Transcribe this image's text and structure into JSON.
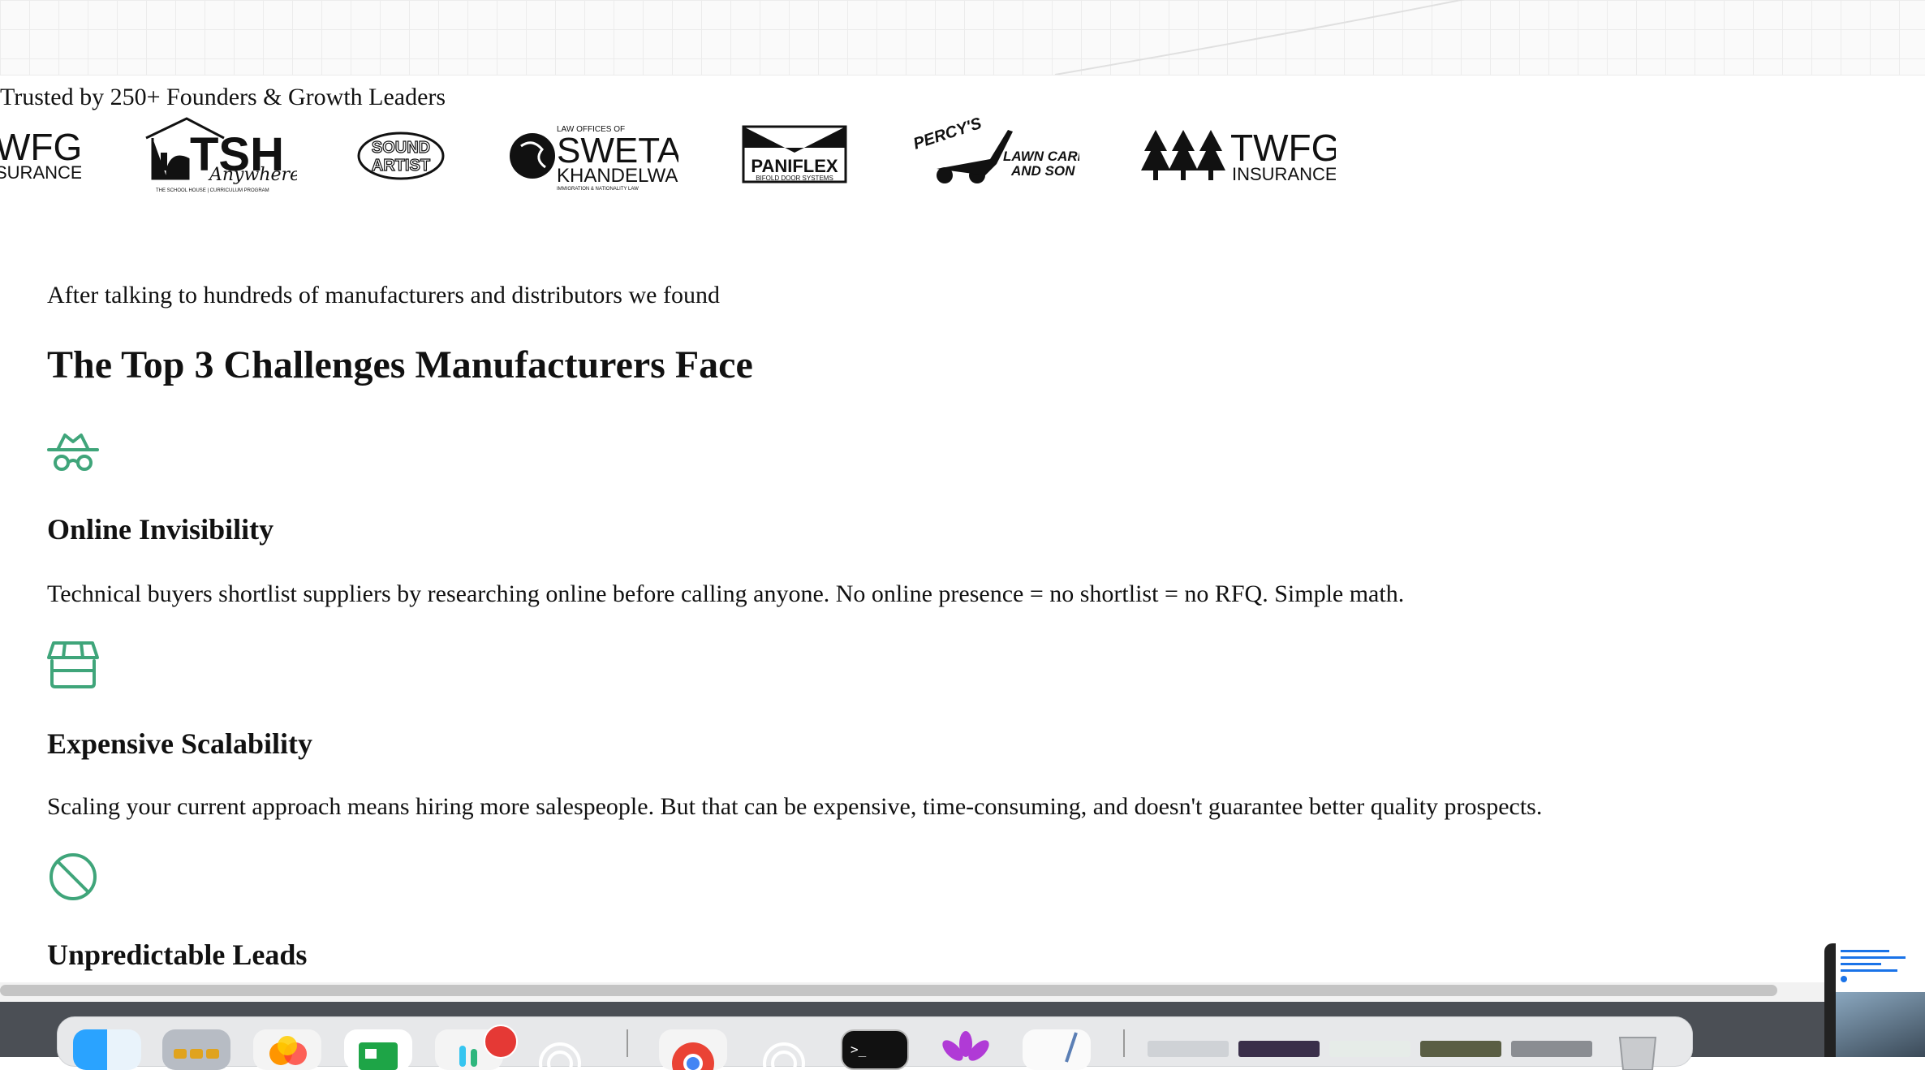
{
  "trusted": {
    "text": "Trusted by 250+ Founders & Growth Leaders"
  },
  "logos": [
    {
      "name": "twfg-insurance-partial",
      "line1": "WFG",
      "line2": "SURANCE"
    },
    {
      "name": "tsh-anywhere",
      "main": "TSH",
      "script": "Anywhere",
      "sub": "THE SCHOOL HOUSE | CURRICULUM PROGRAM"
    },
    {
      "name": "sound-artist",
      "line1": "SOUND",
      "line2": "ARTIST"
    },
    {
      "name": "sweta-khandelwal",
      "top": "LAW OFFICES OF",
      "main": "SWETA",
      "second": "KHANDELWAL",
      "sub": "IMMIGRATION & NATIONALITY LAW"
    },
    {
      "name": "paniflex",
      "main": "PANIFLEX",
      "sub": "BIFOLD DOOR SYSTEMS"
    },
    {
      "name": "percys-lawn-care",
      "top": "PERCY'S",
      "line1": "LAWN CARE",
      "line2": "AND SON"
    },
    {
      "name": "twfg-insurance",
      "main": "TWFG",
      "sub": "INSURANCE"
    }
  ],
  "intro": "After talking to hundreds of manufacturers and distributors we found",
  "title": "The Top 3 Challenges Manufacturers Face",
  "challenges": [
    {
      "icon": "incognito-icon",
      "title": "Online Invisibility",
      "description": "Technical buyers shortlist suppliers by researching online before calling anyone. No online presence = no shortlist = no RFQ. Simple math."
    },
    {
      "icon": "storefront-icon",
      "title": "Expensive Scalability",
      "description": "Scaling your current approach means hiring more salespeople. But that can be expensive, time-consuming, and doesn't guarantee better quality prospects."
    },
    {
      "icon": "prohibited-icon",
      "title": "Unpredictable Leads"
    }
  ],
  "colors": {
    "accent": "#3fa57a",
    "text": "#111111"
  },
  "dock": {
    "apps": [
      "finder",
      "launchpad",
      "photos",
      "numbers",
      "slack",
      "chatgpt",
      "chrome",
      "chatgpt-2",
      "terminal",
      "flower-app",
      "textedit"
    ],
    "badge_app": "slack"
  }
}
